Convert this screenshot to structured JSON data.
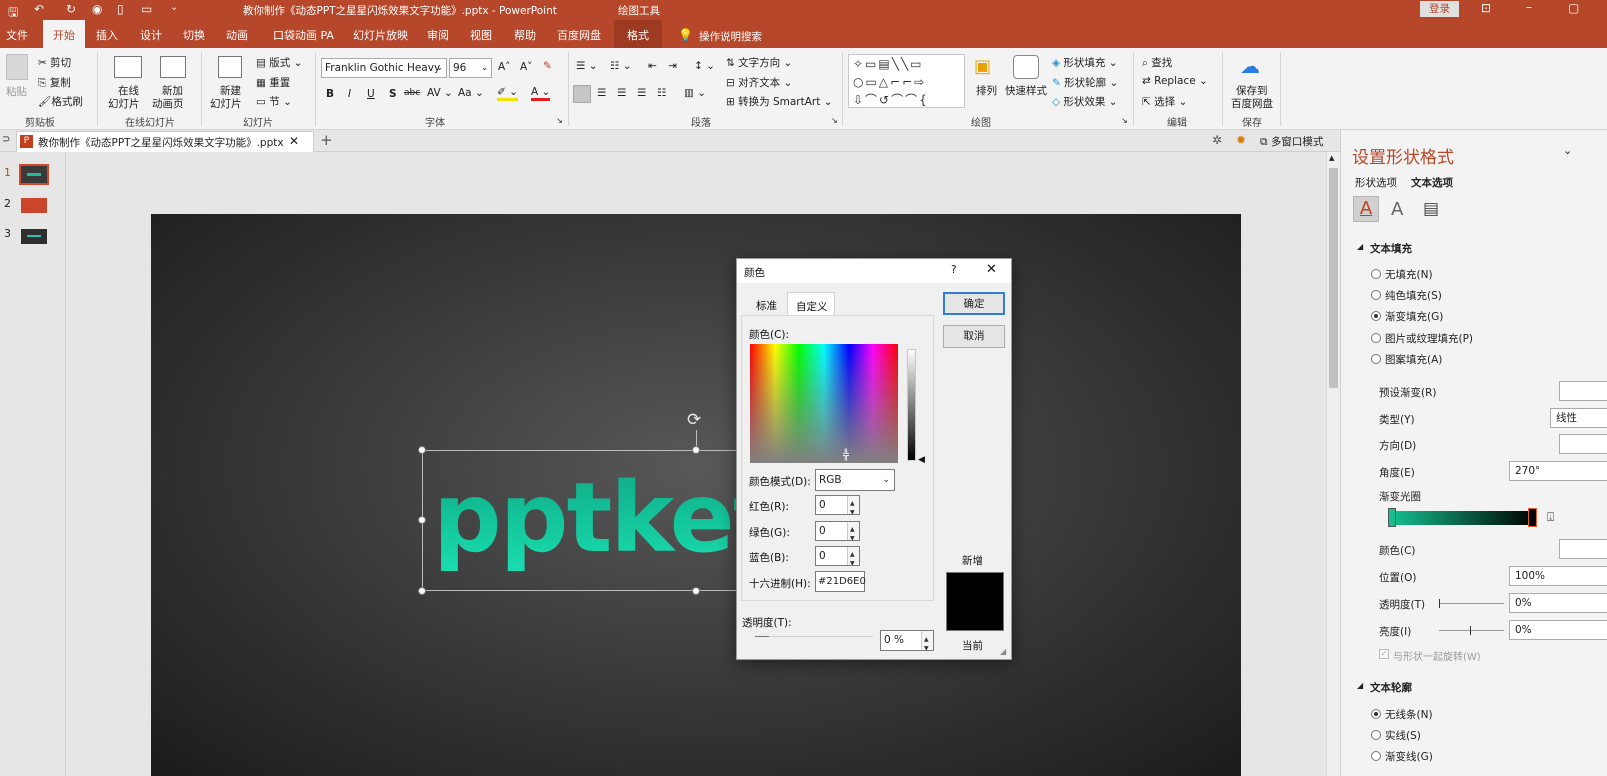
{
  "titlebar": {
    "doc_title": "教你制作《动态PPT之星星闪烁效果文字功能》.pptx  -  PowerPoint",
    "tools_label": "绘图工具",
    "login_label": "登录"
  },
  "ribbon_tabs": [
    "文件",
    "开始",
    "插入",
    "设计",
    "切换",
    "动画",
    "口袋动画 PA",
    "幻灯片放映",
    "审阅",
    "视图",
    "帮助",
    "百度网盘",
    "格式"
  ],
  "tell_me": "操作说明搜索",
  "clipboard": {
    "paste": "粘贴",
    "cut": "剪切",
    "copy": "复制",
    "format_painter": "格式刷",
    "group": "剪贴板"
  },
  "online_slides": {
    "online": "在线",
    "online2": "幻灯片",
    "new_anim": "新加",
    "new_anim2": "动画页",
    "group": "在线幻灯片"
  },
  "slides": {
    "new": "新建",
    "new2": "幻灯片",
    "layout": "版式",
    "reset": "重置",
    "section": "节",
    "group": "幻灯片"
  },
  "font": {
    "name": "Franklin Gothic Heavy",
    "size": "96",
    "group": "字体"
  },
  "paragraph": {
    "text_dir": "文字方向",
    "align_text": "对齐文本",
    "smartart": "转换为 SmartArt",
    "group": "段落"
  },
  "drawing": {
    "arrange": "排列",
    "quick_styles": "快速样式",
    "fill": "形状填充",
    "outline": "形状轮廓",
    "effects": "形状效果",
    "group": "绘图"
  },
  "editing": {
    "find": "查找",
    "replace": "Replace",
    "select": "选择",
    "group": "编辑"
  },
  "save": {
    "label1": "保存到",
    "label2": "百度网盘",
    "group": "保存"
  },
  "doc_tab": {
    "name": "教你制作《动态PPT之星星闪烁效果文字功能》.pptx",
    "multiwindow": "多窗口模式"
  },
  "thumbnails": [
    "1",
    "2",
    "3"
  ],
  "slide_text": "pptket",
  "color_dialog": {
    "title": "颜色",
    "help": "?",
    "tab_standard": "标准",
    "tab_custom": "自定义",
    "colors_label": "颜色(C):",
    "model_label": "颜色模式(D):",
    "model_value": "RGB",
    "red_label": "红色(R):",
    "red_value": "0",
    "green_label": "绿色(G):",
    "green_value": "0",
    "blue_label": "蓝色(B):",
    "blue_value": "0",
    "hex_label": "十六进制(H):",
    "hex_value": "#21D6E0",
    "transparency_label": "透明度(T):",
    "transparency_value": "0 %",
    "ok": "确定",
    "cancel": "取消",
    "new_label": "新增",
    "current_label": "当前",
    "new_color": "#000000"
  },
  "format_pane": {
    "title": "设置形状格式",
    "tab_shape": "形状选项",
    "tab_text": "文本选项",
    "section_fill": "文本填充",
    "fill_options": [
      "无填充(N)",
      "纯色填充(S)",
      "渐变填充(G)",
      "图片或纹理填充(P)",
      "图案填充(A)"
    ],
    "selected_fill": "渐变填充(G)",
    "preset": "预设渐变(R)",
    "type": "类型(Y)",
    "type_value": "线性",
    "direction": "方向(D)",
    "angle": "角度(E)",
    "angle_value": "270°",
    "stops": "渐变光圈",
    "color": "颜色(C)",
    "position": "位置(O)",
    "position_value": "100%",
    "transparency": "透明度(T)",
    "transparency_value": "0%",
    "brightness": "亮度(I)",
    "brightness_value": "0%",
    "rotate_with_shape": "与形状一起旋转(W)",
    "section_outline": "文本轮廓",
    "outline_options": [
      "无线条(N)",
      "实线(S)",
      "渐变线(G)"
    ]
  },
  "colors": {
    "accent": "#b7472a",
    "gradient_start": "#15c08f",
    "gradient_end": "#000000",
    "text_top": "#0fa783",
    "text_bottom": "#19e0b1"
  }
}
